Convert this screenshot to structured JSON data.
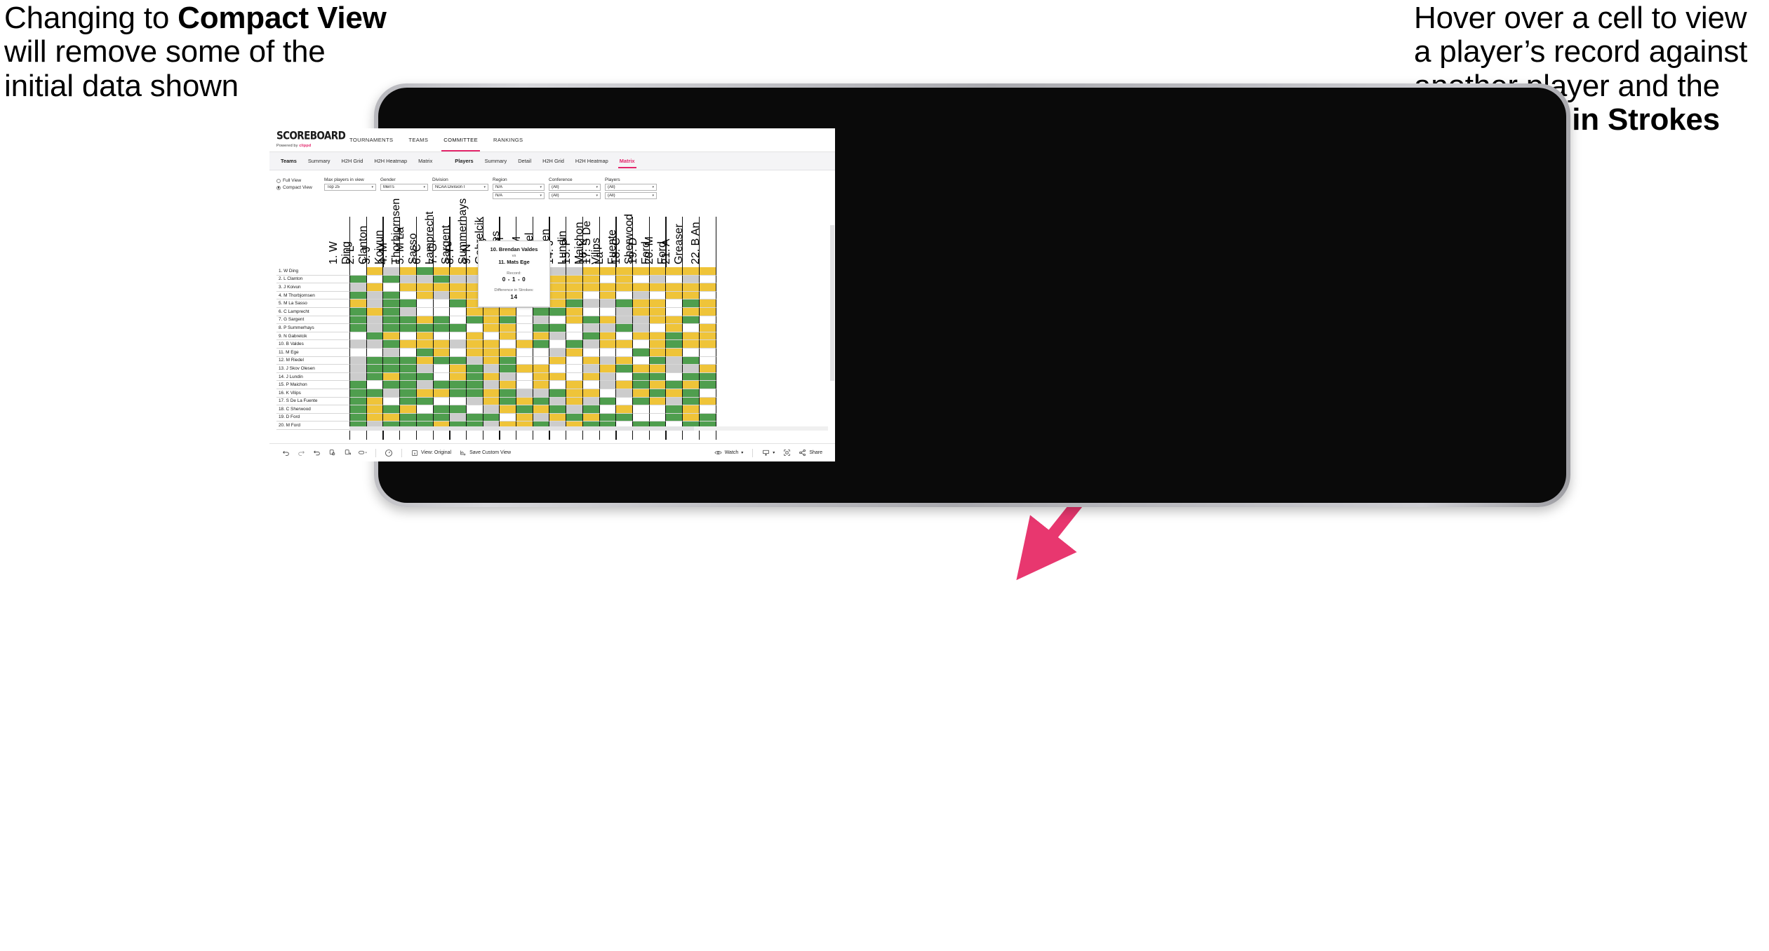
{
  "annotations": {
    "left": {
      "lines": [
        {
          "t": "Changing to ",
          "b": false
        },
        {
          "t": "Compact View",
          "b": true
        },
        {
          "t": " will remove some of the initial data shown",
          "b": false
        }
      ],
      "plain": "Changing to Compact View will remove some of the initial data shown"
    },
    "right": {
      "plain": "Hover over a cell to view a player’s record against another player and the Difference in Strokes",
      "bold_part": "Difference in Strokes"
    },
    "arrow_color": "#e8376f"
  },
  "app": {
    "brand": {
      "name": "SCOREBOARD",
      "powered_prefix": "Powered by ",
      "powered_by": "clippd"
    },
    "top_nav": [
      {
        "label": "TOURNAMENTS",
        "active": false
      },
      {
        "label": "TEAMS",
        "active": false
      },
      {
        "label": "COMMITTEE",
        "active": true
      },
      {
        "label": "RANKINGS",
        "active": false
      }
    ],
    "sub_nav": {
      "teams_group_label": "Teams",
      "teams_items": [
        {
          "label": "Summary",
          "active": false
        },
        {
          "label": "H2H Grid",
          "active": false
        },
        {
          "label": "H2H Heatmap",
          "active": false
        },
        {
          "label": "Matrix",
          "active": false
        }
      ],
      "players_group_label": "Players",
      "players_items": [
        {
          "label": "Summary",
          "active": false
        },
        {
          "label": "Detail",
          "active": false
        },
        {
          "label": "H2H Grid",
          "active": false
        },
        {
          "label": "H2H Heatmap",
          "active": false
        },
        {
          "label": "Matrix",
          "active": true
        }
      ]
    },
    "filters": {
      "view_mode": {
        "options": [
          {
            "label": "Full View",
            "selected": false
          },
          {
            "label": "Compact View",
            "selected": true
          }
        ]
      },
      "selects": [
        {
          "label": "Max players in view",
          "value": "Top 25",
          "width": "w1"
        },
        {
          "label": "Gender",
          "value": "Men's",
          "width": "w2"
        },
        {
          "label": "Division",
          "value": "NCAA Division I",
          "width": "w3"
        },
        {
          "label": "Region",
          "value": "N/A",
          "value2": "N/A",
          "width": "w4"
        },
        {
          "label": "Conference",
          "value": "(All)",
          "value2": "(All)",
          "width": "w4"
        },
        {
          "label": "Players",
          "value": "(All)",
          "value2": "(All)",
          "width": "w4"
        }
      ]
    },
    "toolbar": {
      "icons": [
        "undo-icon",
        "redo-icon",
        "revert-icon",
        "refresh-icon",
        "pause-icon",
        "highlight-icon"
      ],
      "view_label": "View: Original",
      "save_label": "Save Custom View",
      "watch_label": "Watch",
      "share_label": "Share"
    }
  },
  "matrix": {
    "row_labels": [
      "1. W Ding",
      "2. L Clanton",
      "3. J Koivun",
      "4. M Thorbjornsen",
      "5. M La Sasso",
      "6. C Lamprecht",
      "7. G Sargent",
      "8. P Summerhays",
      "9. N Gabrelcik",
      "10. B Valdes",
      "11. M Ege",
      "12. M Riedel",
      "13. J Skov Olesen",
      "14. J Lundin",
      "15. P Maichon",
      "16. K Vilips",
      "17. S De La Fuente",
      "18. C Sherwood",
      "19. D Ford",
      "20. M Ford"
    ],
    "col_labels": [
      "1. W Ding",
      "2. L Clanton",
      "3. J Koivun",
      "4. M Thorbjornsen",
      "5. M La Sasso",
      "6. C Lamprecht",
      "7. G Sargent",
      "8. P Summerhays",
      "9. N Gabrelcik",
      "10. B Valdes",
      "11. M Ege",
      "12. M Riedel",
      "13. J Skov Olesen",
      "14. J Lundin",
      "15. P Maichon",
      "16. K Vilips",
      "17. S De La Fuente",
      "18. C Sherwood",
      "19. D Ford",
      "20. M Ford",
      "21. A Greaser",
      "22. B An"
    ],
    "legend_colors": {
      "win": "#4f9e4e",
      "loss": "#efc439",
      "tie": "#cccccc",
      "none": "#ffffff"
    },
    "cells": [
      [
        "n",
        "y",
        "a",
        "y",
        "g",
        "y",
        "y",
        "y",
        "w",
        "a",
        "w",
        "y",
        "a",
        "a",
        "y",
        "y",
        "y",
        "y",
        "y",
        "y",
        "y",
        "y"
      ],
      [
        "g",
        "n",
        "g",
        "a",
        "a",
        "g",
        "a",
        "a",
        "a",
        "y",
        "a",
        "w",
        "y",
        "y",
        "y",
        "w",
        "y",
        "w",
        "a",
        "w",
        "a",
        "w"
      ],
      [
        "a",
        "y",
        "n",
        "y",
        "y",
        "y",
        "y",
        "y",
        "y",
        "g",
        "y",
        "a",
        "y",
        "y",
        "y",
        "y",
        "y",
        "y",
        "y",
        "y",
        "y",
        "y"
      ],
      [
        "g",
        "a",
        "g",
        "n",
        "y",
        "a",
        "y",
        "y",
        "y",
        "y",
        "g",
        "w",
        "y",
        "y",
        "w",
        "y",
        "w",
        "a",
        "w",
        "y",
        "y",
        "w"
      ],
      [
        "y",
        "a",
        "g",
        "g",
        "n",
        "w",
        "g",
        "y",
        "y",
        "y",
        "g",
        "g",
        "y",
        "g",
        "a",
        "a",
        "g",
        "y",
        "y",
        "w",
        "g",
        "y"
      ],
      [
        "g",
        "y",
        "g",
        "a",
        "w",
        "n",
        "w",
        "y",
        "y",
        "y",
        "w",
        "g",
        "g",
        "y",
        "w",
        "w",
        "a",
        "y",
        "y",
        "w",
        "y",
        "y"
      ],
      [
        "g",
        "a",
        "g",
        "g",
        "y",
        "g",
        "n",
        "g",
        "y",
        "g",
        "w",
        "a",
        "w",
        "y",
        "g",
        "y",
        "a",
        "a",
        "y",
        "y",
        "g",
        "w"
      ],
      [
        "g",
        "a",
        "g",
        "g",
        "g",
        "g",
        "g",
        "n",
        "y",
        "y",
        "w",
        "g",
        "g",
        "w",
        "a",
        "a",
        "g",
        "a",
        "w",
        "y",
        "w",
        "y"
      ],
      [
        "w",
        "g",
        "y",
        "w",
        "y",
        "w",
        "w",
        "y",
        "n",
        "y",
        "w",
        "y",
        "a",
        "w",
        "g",
        "y",
        "w",
        "y",
        "y",
        "g",
        "y",
        "y"
      ],
      [
        "a",
        "a",
        "g",
        "y",
        "y",
        "y",
        "a",
        "y",
        "y",
        "n",
        "y",
        "g",
        "w",
        "g",
        "a",
        "y",
        "y",
        "w",
        "y",
        "g",
        "y",
        "y"
      ],
      [
        "w",
        "w",
        "a",
        "w",
        "g",
        "y",
        "w",
        "y",
        "y",
        "y",
        "n",
        "w",
        "a",
        "y",
        "w",
        "w",
        "w",
        "g",
        "y",
        "y",
        "w",
        "w"
      ],
      [
        "a",
        "g",
        "g",
        "g",
        "y",
        "g",
        "g",
        "a",
        "y",
        "g",
        "w",
        "n",
        "y",
        "w",
        "y",
        "a",
        "y",
        "w",
        "g",
        "a",
        "g",
        "w"
      ],
      [
        "a",
        "g",
        "g",
        "g",
        "a",
        "w",
        "y",
        "g",
        "a",
        "g",
        "y",
        "y",
        "n",
        "w",
        "a",
        "y",
        "g",
        "y",
        "y",
        "a",
        "a",
        "y"
      ],
      [
        "a",
        "g",
        "y",
        "g",
        "g",
        "w",
        "y",
        "g",
        "y",
        "a",
        "w",
        "y",
        "y",
        "n",
        "y",
        "a",
        "w",
        "g",
        "g",
        "w",
        "g",
        "g"
      ],
      [
        "g",
        "w",
        "g",
        "g",
        "a",
        "g",
        "g",
        "g",
        "a",
        "y",
        "w",
        "y",
        "w",
        "y",
        "n",
        "a",
        "y",
        "g",
        "y",
        "g",
        "y",
        "g"
      ],
      [
        "g",
        "g",
        "a",
        "g",
        "y",
        "y",
        "g",
        "g",
        "y",
        "g",
        "a",
        "a",
        "g",
        "y",
        "y",
        "n",
        "a",
        "y",
        "g",
        "y",
        "g",
        "w"
      ],
      [
        "g",
        "y",
        "w",
        "g",
        "g",
        "w",
        "w",
        "a",
        "y",
        "g",
        "y",
        "g",
        "a",
        "y",
        "a",
        "g",
        "n",
        "g",
        "y",
        "a",
        "g",
        "y"
      ],
      [
        "g",
        "y",
        "g",
        "y",
        "w",
        "g",
        "g",
        "w",
        "a",
        "y",
        "g",
        "y",
        "g",
        "a",
        "g",
        "w",
        "y",
        "n",
        "w",
        "g",
        "y",
        "w"
      ],
      [
        "g",
        "y",
        "y",
        "g",
        "g",
        "g",
        "a",
        "g",
        "g",
        "w",
        "y",
        "a",
        "y",
        "g",
        "y",
        "g",
        "g",
        "w",
        "n",
        "g",
        "y",
        "g"
      ],
      [
        "g",
        "a",
        "g",
        "g",
        "g",
        "y",
        "g",
        "g",
        "a",
        "y",
        "y",
        "g",
        "a",
        "y",
        "g",
        "g",
        "w",
        "g",
        "g",
        "n",
        "g",
        "g"
      ]
    ]
  },
  "tooltip": {
    "player_a": "10. Brendan Valdes",
    "vs": "vs",
    "player_b": "11. Mats Ege",
    "record_label": "Record:",
    "record_value": "0 - 1 - 0",
    "diff_label": "Difference in Strokes:",
    "diff_value": "14"
  }
}
